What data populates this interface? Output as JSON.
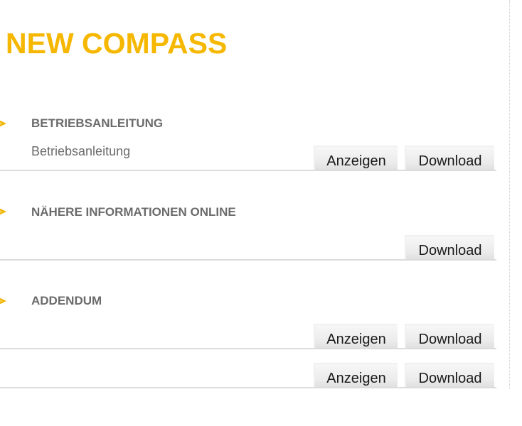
{
  "title": "NEW COMPASS",
  "colors": {
    "title": "#f5b700",
    "heading_text": "#6b6b6b",
    "icon": "#f0b400"
  },
  "sections": [
    {
      "icon": "arrow-right-icon",
      "heading": "BETRIEBSANLEITUNG",
      "items": [
        {
          "label": "Betriebsanleitung",
          "view_label": "Anzeigen",
          "download_label": "Download"
        }
      ]
    },
    {
      "icon": "arrow-right-icon",
      "heading": "NÄHERE INFORMATIONEN ONLINE",
      "items": [
        {
          "label": "",
          "download_label": "Download"
        }
      ]
    },
    {
      "icon": "arrow-right-icon",
      "heading": "ADDENDUM",
      "items": [
        {
          "label": "",
          "view_label": "Anzeigen",
          "download_label": "Download"
        },
        {
          "label": "",
          "view_label": "Anzeigen",
          "download_label": "Download"
        }
      ]
    }
  ]
}
